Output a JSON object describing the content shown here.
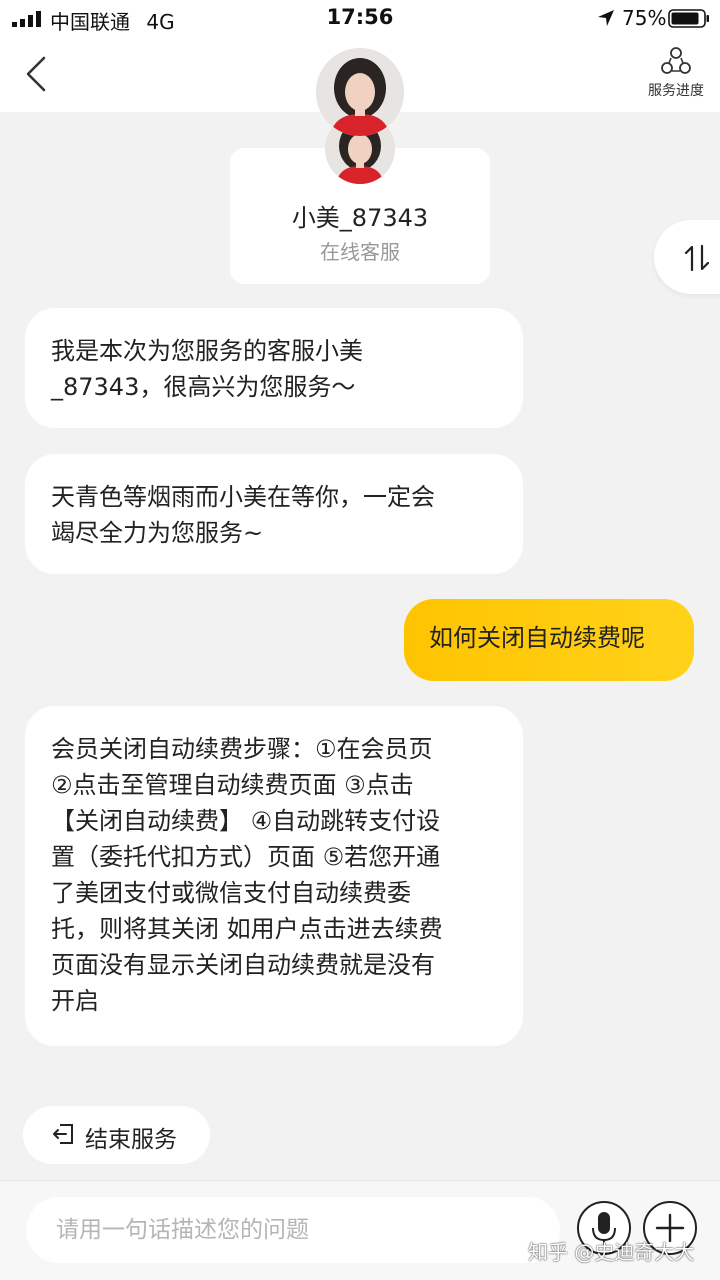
{
  "status_bar": {
    "carrier": "中国联通",
    "network": "4G",
    "time": "17:56",
    "battery": "75%",
    "icons": [
      "signal-icon",
      "location-icon",
      "battery-icon"
    ]
  },
  "header": {
    "back_icon": "chevron-left-icon",
    "progress_label": "服务进度",
    "progress_icon": "service-progress-icon"
  },
  "agent": {
    "name": "小美_87343",
    "role": "在线客服"
  },
  "messages": [
    {
      "from": "agent",
      "text": "我是本次为您服务的客服小美\n_87343，很高兴为您服务～"
    },
    {
      "from": "agent",
      "text": "天青色等烟雨而小美在等你，一定会\n竭尽全力为您服务~"
    },
    {
      "from": "user",
      "text": "如何关闭自动续费呢"
    },
    {
      "from": "agent",
      "text": "会员关闭自动续费步骤：①在会员页\n②点击至管理自动续费页面 ③点击\n【关闭自动续费】 ④自动跳转支付设\n置（委托代扣方式）页面 ⑤若您开通\n了美团支付或微信支付自动续费委\n托，则将其关闭 如用户点击进去续费\n页面没有显示关闭自动续费就是没有\n开启"
    }
  ],
  "end_service": {
    "label": "结束服务",
    "icon": "exit-icon"
  },
  "input": {
    "placeholder": "请用一句话描述您的问题",
    "value": ""
  },
  "watermark": "知乎 @史迪奇大大",
  "colors": {
    "accent": "#ffc400",
    "background": "#f2f2f2",
    "bubble": "#ffffff"
  }
}
